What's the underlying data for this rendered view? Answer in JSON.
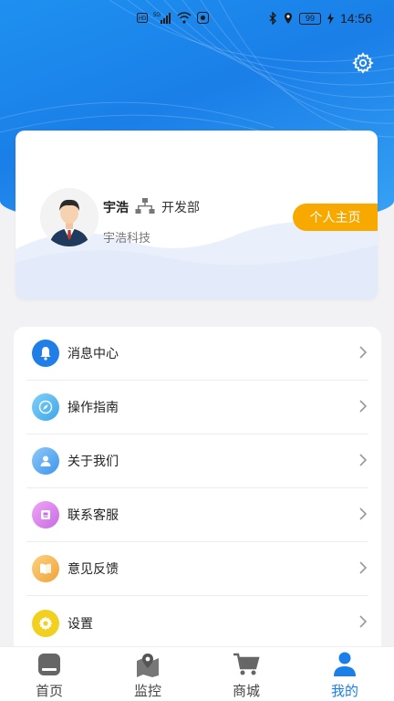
{
  "status_bar": {
    "left_icons": [
      "hd-icon",
      "5g-signal-icon",
      "wifi-icon",
      "notification-icon"
    ],
    "right_icons": [
      "bluetooth-icon",
      "location-icon"
    ],
    "battery_level": "99",
    "time": "14:56"
  },
  "profile": {
    "name": "宇浩",
    "department": "开发部",
    "company": "宇浩科技",
    "homepage_label": "个人主页"
  },
  "menu": [
    {
      "label": "消息中心",
      "icon": "bell-icon",
      "color": "#1f7fe6"
    },
    {
      "label": "操作指南",
      "icon": "compass-icon",
      "color": "#5ab8f0"
    },
    {
      "label": "关于我们",
      "icon": "user-badge-icon",
      "color": "#4aa6f2"
    },
    {
      "label": "联系客服",
      "icon": "service-icon",
      "color": "#d67ee8"
    },
    {
      "label": "意见反馈",
      "icon": "book-icon",
      "color": "#f6b24a"
    },
    {
      "label": "设置",
      "icon": "gear-icon",
      "color": "#f2d020"
    }
  ],
  "nav": [
    {
      "label": "首页",
      "icon": "home-icon",
      "active": false
    },
    {
      "label": "监控",
      "icon": "map-pin-icon",
      "active": false
    },
    {
      "label": "商城",
      "icon": "cart-icon",
      "active": false
    },
    {
      "label": "我的",
      "icon": "profile-icon",
      "active": true
    }
  ],
  "colors": {
    "header_blue": "#1a7fe8",
    "accent_orange": "#f7a900",
    "active_nav": "#1a7fe8"
  }
}
